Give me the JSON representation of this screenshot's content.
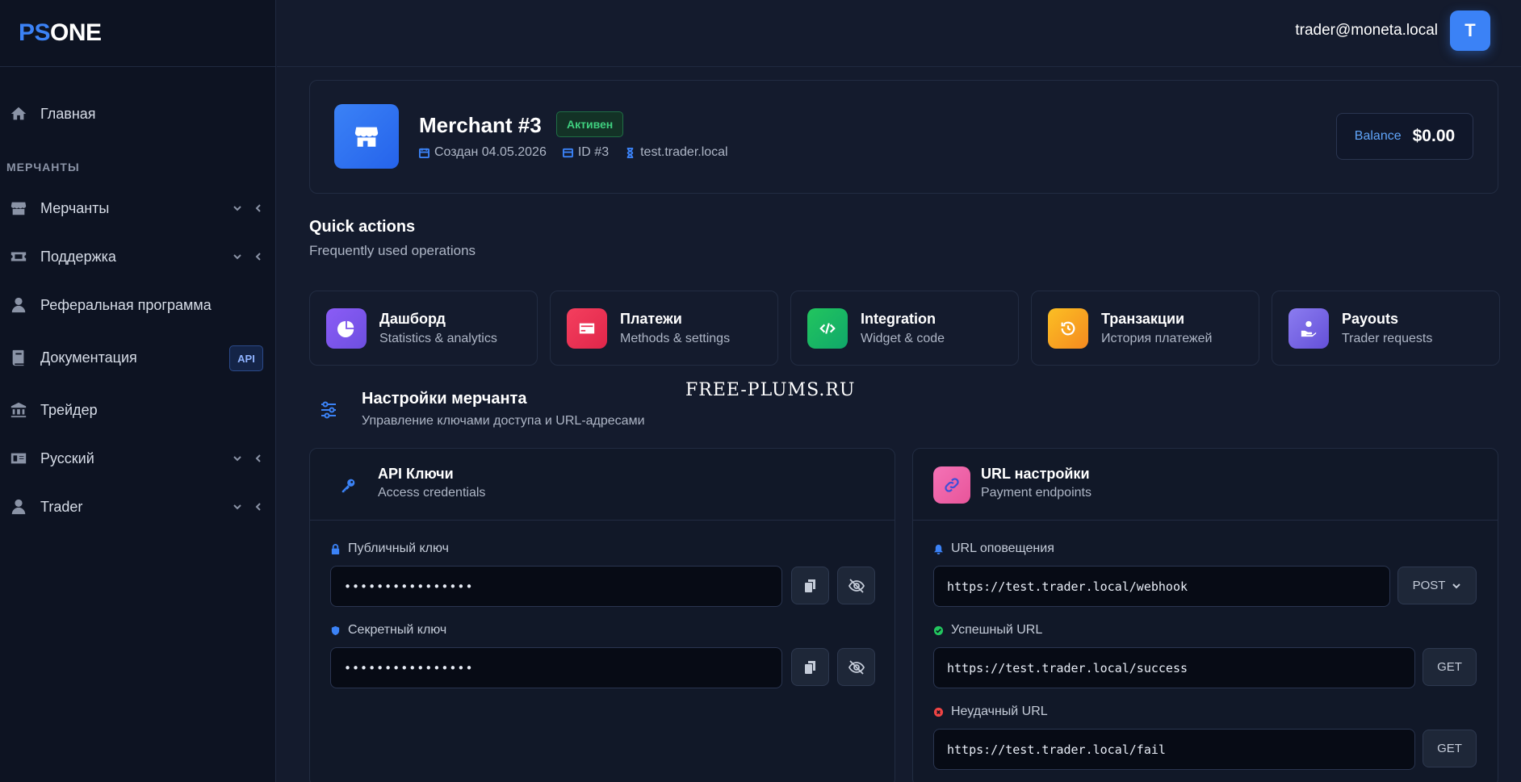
{
  "brand": {
    "part1": "PS",
    "part2": "ONE"
  },
  "header": {
    "user_email": "trader@moneta.local",
    "avatar_letter": "T"
  },
  "sidebar": {
    "section_label": "МЕРЧАНТЫ",
    "items": [
      {
        "label": "Главная",
        "icon": "home-icon"
      },
      {
        "label": "Мерчанты",
        "icon": "store-icon"
      },
      {
        "label": "Поддержка",
        "icon": "ticket-icon"
      },
      {
        "label": "Реферальная программа",
        "icon": "user-icon"
      },
      {
        "label": "Документация",
        "icon": "book-icon",
        "badge": "API"
      },
      {
        "label": "Трейдер",
        "icon": "bank-icon"
      },
      {
        "label": "Русский",
        "icon": "language-icon"
      },
      {
        "label": "Trader",
        "icon": "user-icon"
      }
    ]
  },
  "merchant": {
    "name": "Merchant #3",
    "status": "Активен",
    "created": "Создан 04.05.2026",
    "id": "ID #3",
    "domain": "test.trader.local",
    "balance_label": "Balance",
    "balance_value": "$0.00"
  },
  "quick_actions": {
    "title": "Quick actions",
    "subtitle": "Frequently used operations",
    "items": [
      {
        "label": "Дашборд",
        "desc": "Statistics & analytics",
        "icon": "pie-chart-icon",
        "color": "#7c5cf0"
      },
      {
        "label": "Платежи",
        "desc": "Methods & settings",
        "icon": "credit-card-icon",
        "color": "#ef3b5a"
      },
      {
        "label": "Integration",
        "desc": "Widget & code",
        "icon": "code-icon",
        "color": "#22c07a"
      },
      {
        "label": "Транзакции",
        "desc": "История платежей",
        "icon": "history-icon",
        "color": "#f59e2a"
      },
      {
        "label": "Payouts",
        "desc": "Trader requests",
        "icon": "hand-coin-icon",
        "color": "#7a62e0"
      }
    ]
  },
  "settings": {
    "title": "Настройки мерчанта",
    "subtitle": "Управление ключами доступа и URL-адресами"
  },
  "watermark": "FREE-PLUMS.RU",
  "api_keys": {
    "title": "API Ключи",
    "subtitle": "Access credentials",
    "public_label": "Публичный ключ",
    "public_value": "••••••••••••••••",
    "secret_label": "Секретный ключ",
    "secret_value": "••••••••••••••••"
  },
  "url_settings": {
    "title": "URL настройки",
    "subtitle": "Payment endpoints",
    "notify_label": "URL оповещения",
    "notify_value": "https://test.trader.local/webhook",
    "notify_method": "POST",
    "success_label": "Успешный URL",
    "success_value": "https://test.trader.local/success",
    "success_method": "GET",
    "fail_label": "Неудачный URL",
    "fail_value": "https://test.trader.local/fail",
    "fail_method": "GET"
  },
  "colors": {
    "accent": "#3b82f6",
    "success": "#22c55e",
    "danger": "#ef4444"
  }
}
